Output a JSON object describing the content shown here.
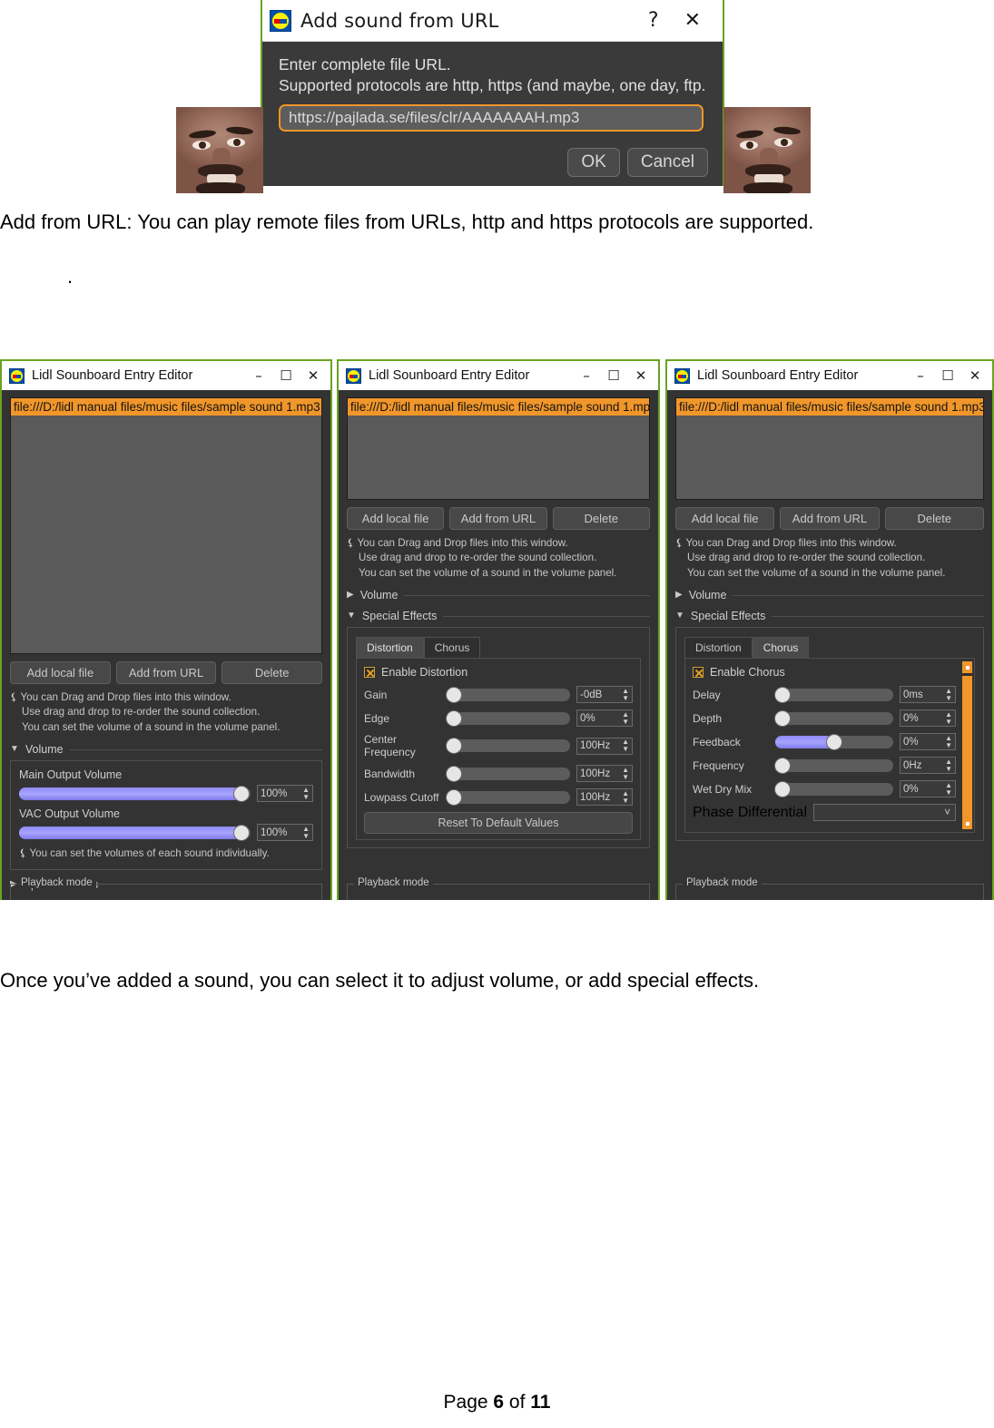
{
  "document": {
    "paragraph_1": "Add from URL:  You can play remote files from URLs, http and https protocols are supported.",
    "stray_period": ".",
    "paragraph_2": "Once you’ve added a sound, you can select it to adjust volume, or add special effects.",
    "footer": {
      "prefix": "Page ",
      "page": "6",
      "middle": " of ",
      "total": "11"
    }
  },
  "url_dialog": {
    "title": "Add sound from URL",
    "help_button": "?",
    "close_button": "✕",
    "hint": "Enter complete file URL.\nSupported protocols are http, https (and maybe, one day, ftp.",
    "url_value": "https://pajlada.se/files/clr/AAAAAAAH.mp3",
    "ok_label": "OK",
    "cancel_label": "Cancel",
    "accent_color": "#f0962a"
  },
  "window_common": {
    "title": "Lidl Sounboard Entry Editor",
    "minimize": "–",
    "maximize": "☐",
    "close": "✕",
    "file_entry": "file:///D:/lidl manual files/music files/sample sound 1.mp3",
    "buttons": {
      "add_local": "Add local file",
      "add_url": "Add from URL",
      "delete": "Delete"
    },
    "tips": {
      "line1": "You can Drag and Drop files into this window.",
      "line2": "Use drag and drop to re-order the sound collection.",
      "line3": "You can set the volume of a sound in the volume panel."
    },
    "sections": {
      "volume": "Volume",
      "special_effects": "Special Effects"
    },
    "playback_group": "Playback mode"
  },
  "window1": {
    "volume_panel": {
      "main_label": "Main Output Volume",
      "main_value": "100%",
      "main_percent": 100,
      "vac_label": "VAC Output Volume",
      "vac_value": "100%",
      "vac_percent": 100,
      "tip": "You can set the volumes of each sound individually."
    }
  },
  "window2": {
    "tabs": [
      {
        "label": "Distortion",
        "active": true
      },
      {
        "label": "Chorus",
        "active": false
      }
    ],
    "enable_label": "Enable Distortion",
    "enabled": true,
    "sliders": [
      {
        "name": "Gain",
        "value": "-0dB",
        "percent": 0
      },
      {
        "name": "Edge",
        "value": "0%",
        "percent": 0
      },
      {
        "name": "Center Frequency",
        "value": "100Hz",
        "percent": 0
      },
      {
        "name": "Bandwidth",
        "value": "100Hz",
        "percent": 0
      },
      {
        "name": "Lowpass Cutoff",
        "value": "100Hz",
        "percent": 0
      }
    ],
    "reset_label": "Reset To Default Values"
  },
  "window3": {
    "tabs": [
      {
        "label": "Distortion",
        "active": false
      },
      {
        "label": "Chorus",
        "active": true
      }
    ],
    "enable_label": "Enable Chorus",
    "enabled": true,
    "sliders": [
      {
        "name": "Delay",
        "value": "0ms",
        "percent": 0
      },
      {
        "name": "Depth",
        "value": "0%",
        "percent": 0
      },
      {
        "name": "Feedback",
        "value": "0%",
        "percent": 50
      },
      {
        "name": "Frequency",
        "value": "0Hz",
        "percent": 0
      },
      {
        "name": "Wet Dry Mix",
        "value": "0%",
        "percent": 0
      }
    ],
    "phase_label": "Phase Differential",
    "phase_value": "",
    "scrollbar_color": "#f0962a"
  }
}
